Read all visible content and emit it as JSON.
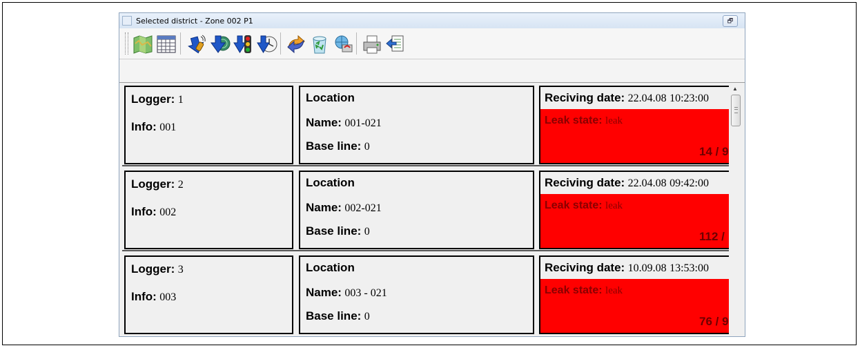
{
  "window": {
    "title": "Selected district - Zone 002 P1",
    "restore_glyph": "🗗"
  },
  "toolbar": {
    "buttons": [
      {
        "icon": "map-icon"
      },
      {
        "icon": "grid-table-icon"
      },
      {
        "icon": "download-signal-icon"
      },
      {
        "icon": "download-radar-icon"
      },
      {
        "icon": "traffic-light-download-icon"
      },
      {
        "icon": "clock-download-icon"
      },
      {
        "icon": "sync-arrows-icon"
      },
      {
        "icon": "recycle-bin-icon"
      },
      {
        "icon": "network-refresh-icon"
      },
      {
        "icon": "printer-icon"
      },
      {
        "icon": "export-report-icon"
      }
    ]
  },
  "labels": {
    "logger": "Logger:",
    "info": "Info:",
    "location": "Location",
    "name": "Name:",
    "base_line": "Base line:",
    "receiving_date": "Reciving date:",
    "leak_state": "Leak state:"
  },
  "loggers": [
    {
      "logger": "1",
      "info": "001",
      "name": "001-021",
      "base_line": "0",
      "date": "22.04.08",
      "time": "10:23:00",
      "leak_state": "leak",
      "count": "14 / 9"
    },
    {
      "logger": "2",
      "info": "002",
      "name": "002-021",
      "base_line": "0",
      "date": "22.04.08",
      "time": "09:42:00",
      "leak_state": "leak",
      "count": "112 /"
    },
    {
      "logger": "3",
      "info": "003",
      "name": "003 - 021",
      "base_line": "0",
      "date": "10.09.08",
      "time": "13:53:00",
      "leak_state": "leak",
      "count": "76 / 9"
    }
  ],
  "colors": {
    "leak_background": "#ff0000",
    "leak_text": "#8a0000"
  }
}
